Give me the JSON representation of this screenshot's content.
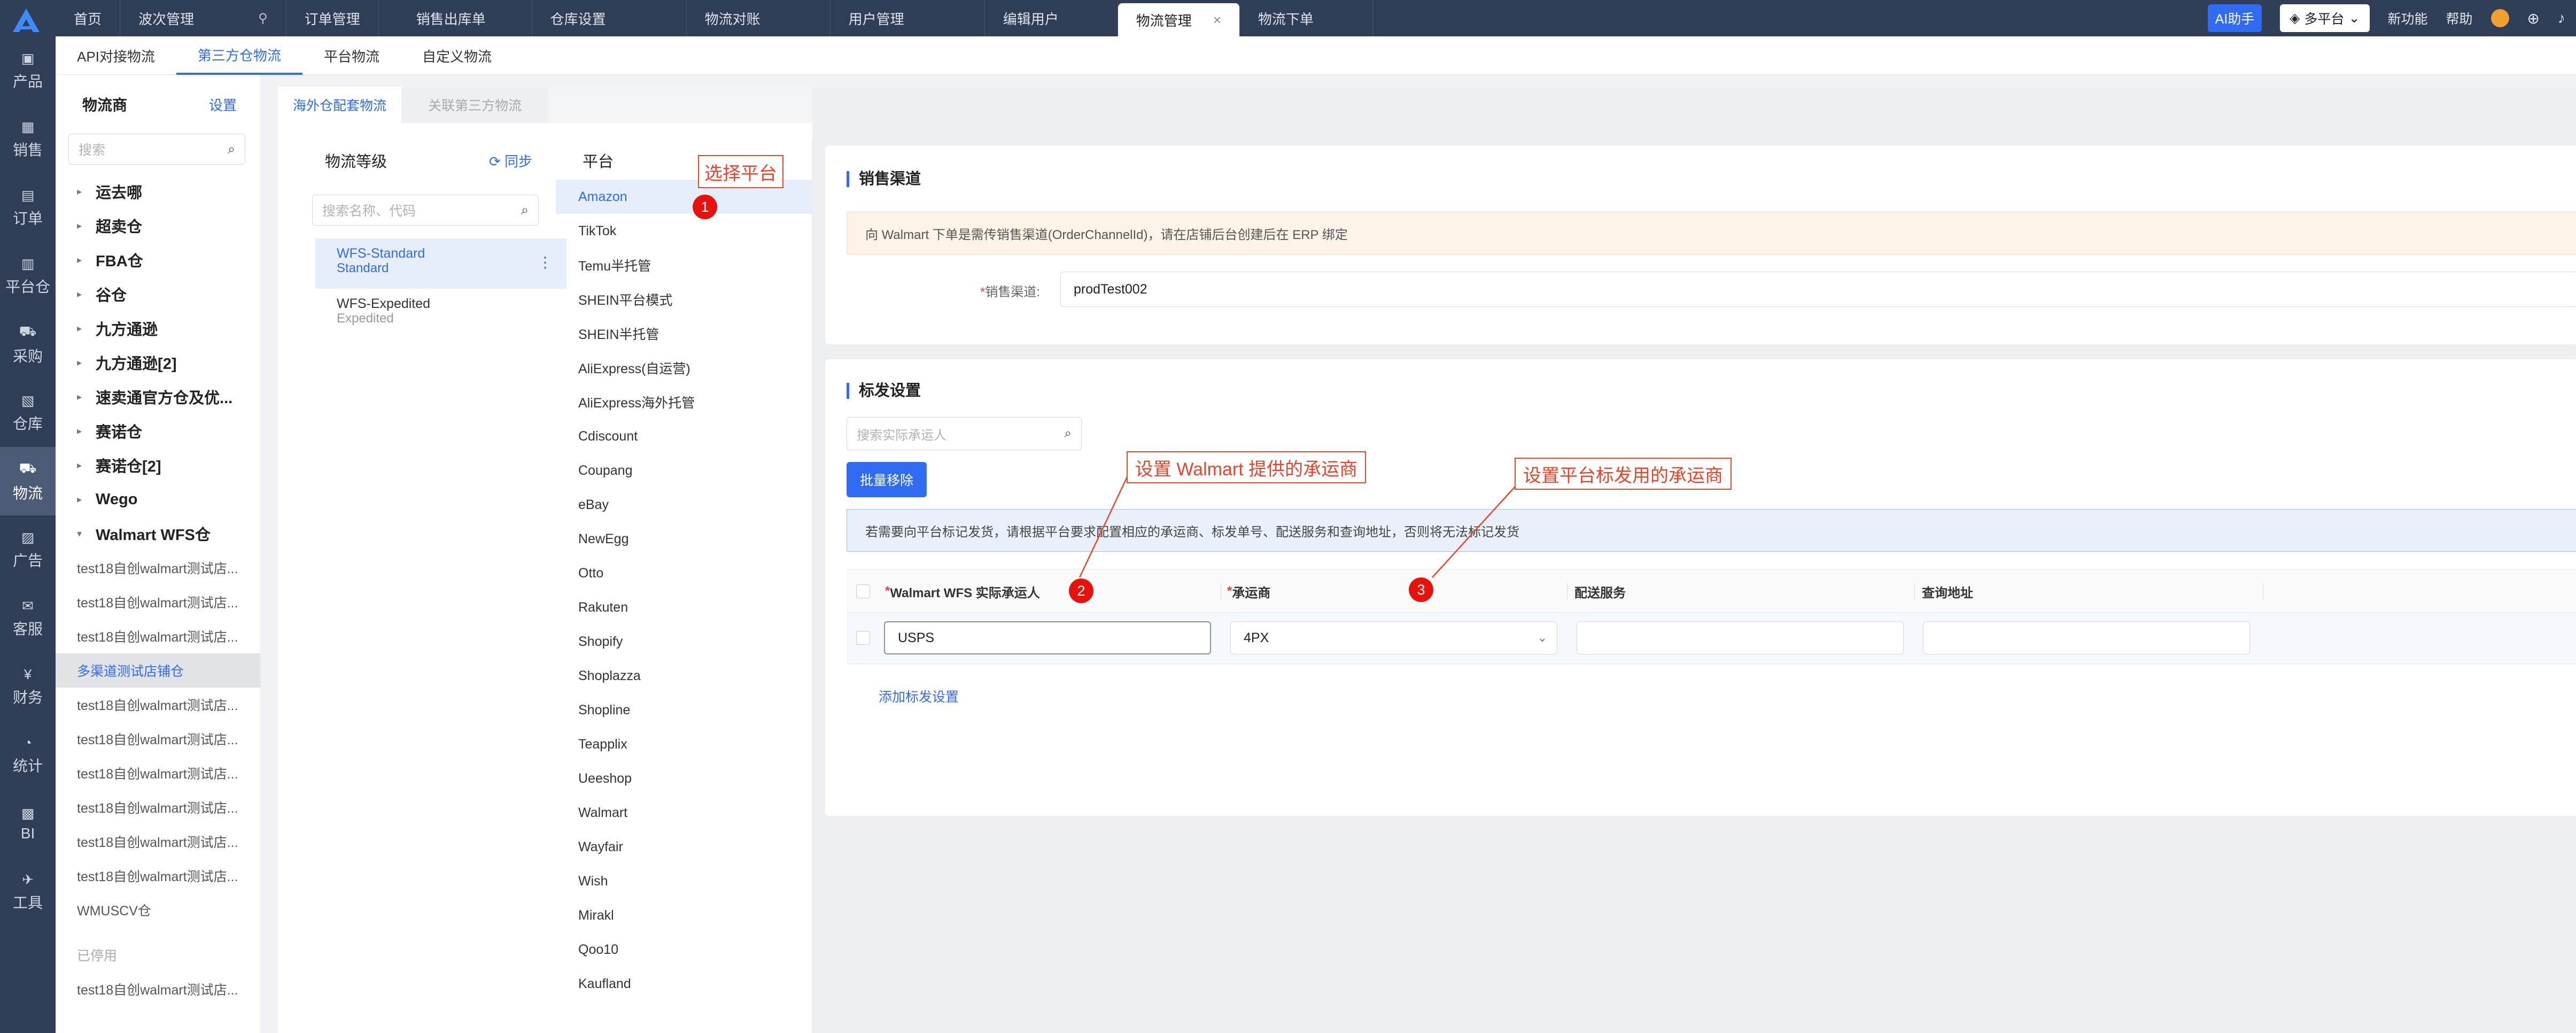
{
  "tabs": [
    {
      "label": "首页"
    },
    {
      "label": "波次管理"
    },
    {
      "label": "订单管理"
    },
    {
      "label": "销售出库单"
    },
    {
      "label": "仓库设置"
    },
    {
      "label": "物流对账"
    },
    {
      "label": "用户管理"
    },
    {
      "label": "编辑用户"
    },
    {
      "label": "物流管理",
      "close": "×"
    },
    {
      "label": "物流下单"
    }
  ],
  "topright": {
    "ai": "AI助手",
    "platform": "多平台",
    "newfeature": "新功能",
    "help": "帮助"
  },
  "rail": [
    {
      "label": "产品"
    },
    {
      "label": "销售"
    },
    {
      "label": "订单"
    },
    {
      "label": "平台仓"
    },
    {
      "label": "采购"
    },
    {
      "label": "仓库"
    },
    {
      "label": "物流"
    },
    {
      "label": "广告"
    },
    {
      "label": "客服"
    },
    {
      "label": "财务"
    },
    {
      "label": "统计"
    },
    {
      "label": "BI"
    },
    {
      "label": "工具"
    }
  ],
  "subnav": [
    {
      "label": "API对接物流"
    },
    {
      "label": "第三方仓物流"
    },
    {
      "label": "平台物流"
    },
    {
      "label": "自定义物流"
    }
  ],
  "providers": {
    "title": "物流商",
    "settings": "设置",
    "search_placeholder": "搜索",
    "groups": [
      "运去哪",
      "超卖仓",
      "FBA仓",
      "谷仓",
      "九方通逊",
      "九方通逊[2]",
      "速卖通官方仓及优...",
      "赛诺仓",
      "赛诺仓[2]",
      "Wego",
      "Walmart WFS仓"
    ],
    "stores": [
      "test18自创walmart测试店...",
      "test18自创walmart测试店...",
      "test18自创walmart测试店...",
      "多渠道测试店铺仓",
      "test18自创walmart测试店...",
      "test18自创walmart测试店...",
      "test18自创walmart测试店...",
      "test18自创walmart测试店...",
      "test18自创walmart测试店...",
      "test18自创walmart测试店...",
      "WMUSCV仓"
    ],
    "disabled_label": "已停用",
    "disabled_store": "test18自创walmart测试店..."
  },
  "content_tabs": [
    {
      "label": "海外仓配套物流"
    },
    {
      "label": "关联第三方物流"
    }
  ],
  "levels": {
    "title": "物流等级",
    "sync": "同步",
    "search_placeholder": "搜索名称、代码",
    "items": [
      {
        "name": "WFS-Standard",
        "sub": "Standard"
      },
      {
        "name": "WFS-Expedited",
        "sub": "Expedited"
      }
    ]
  },
  "platforms": {
    "title": "平台",
    "items": [
      "Amazon",
      "TikTok",
      "Temu半托管",
      "SHEIN平台模式",
      "SHEIN半托管",
      "AliExpress(自运营)",
      "AliExpress海外托管",
      "Cdiscount",
      "Coupang",
      "eBay",
      "NewEgg",
      "Otto",
      "Rakuten",
      "Shopify",
      "Shoplazza",
      "Shopline",
      "Teapplix",
      "Ueeshop",
      "Walmart",
      "Wayfair",
      "Wish",
      "Mirakl",
      "Qoo10",
      "Kaufland"
    ]
  },
  "sales_channel": {
    "title": "销售渠道",
    "notice": "向 Walmart 下单是需传销售渠道(OrderChannelId)，请在店铺后台创建后在 ERP 绑定",
    "label": "销售渠道:",
    "value": "prodTest002"
  },
  "ship_settings": {
    "title": "标发设置",
    "search_placeholder": "搜索实际承运人",
    "batch_remove": "批量移除",
    "notice": "若需要向平台标记发货，请根据平台要求配置相应的承运商、标发单号、配送服务和查询地址，否则将无法标记发货",
    "col_carrier": "Walmart WFS 实际承运人",
    "col_platform_carrier": "承运商",
    "col_service": "配送服务",
    "col_query": "查询地址",
    "row_carrier": "USPS",
    "row_platform_carrier": "4PX",
    "add_link": "添加标发设置"
  },
  "annotations": {
    "a1": "选择平台",
    "a2": "设置 Walmart 提供的承运商",
    "a3": "设置平台标发用的承运商",
    "n1": "1",
    "n2": "2",
    "n3": "3"
  },
  "colors": {
    "brand": "#2f6bf3",
    "nav_bg": "#2f3d57",
    "annotation": "#e8442a"
  }
}
